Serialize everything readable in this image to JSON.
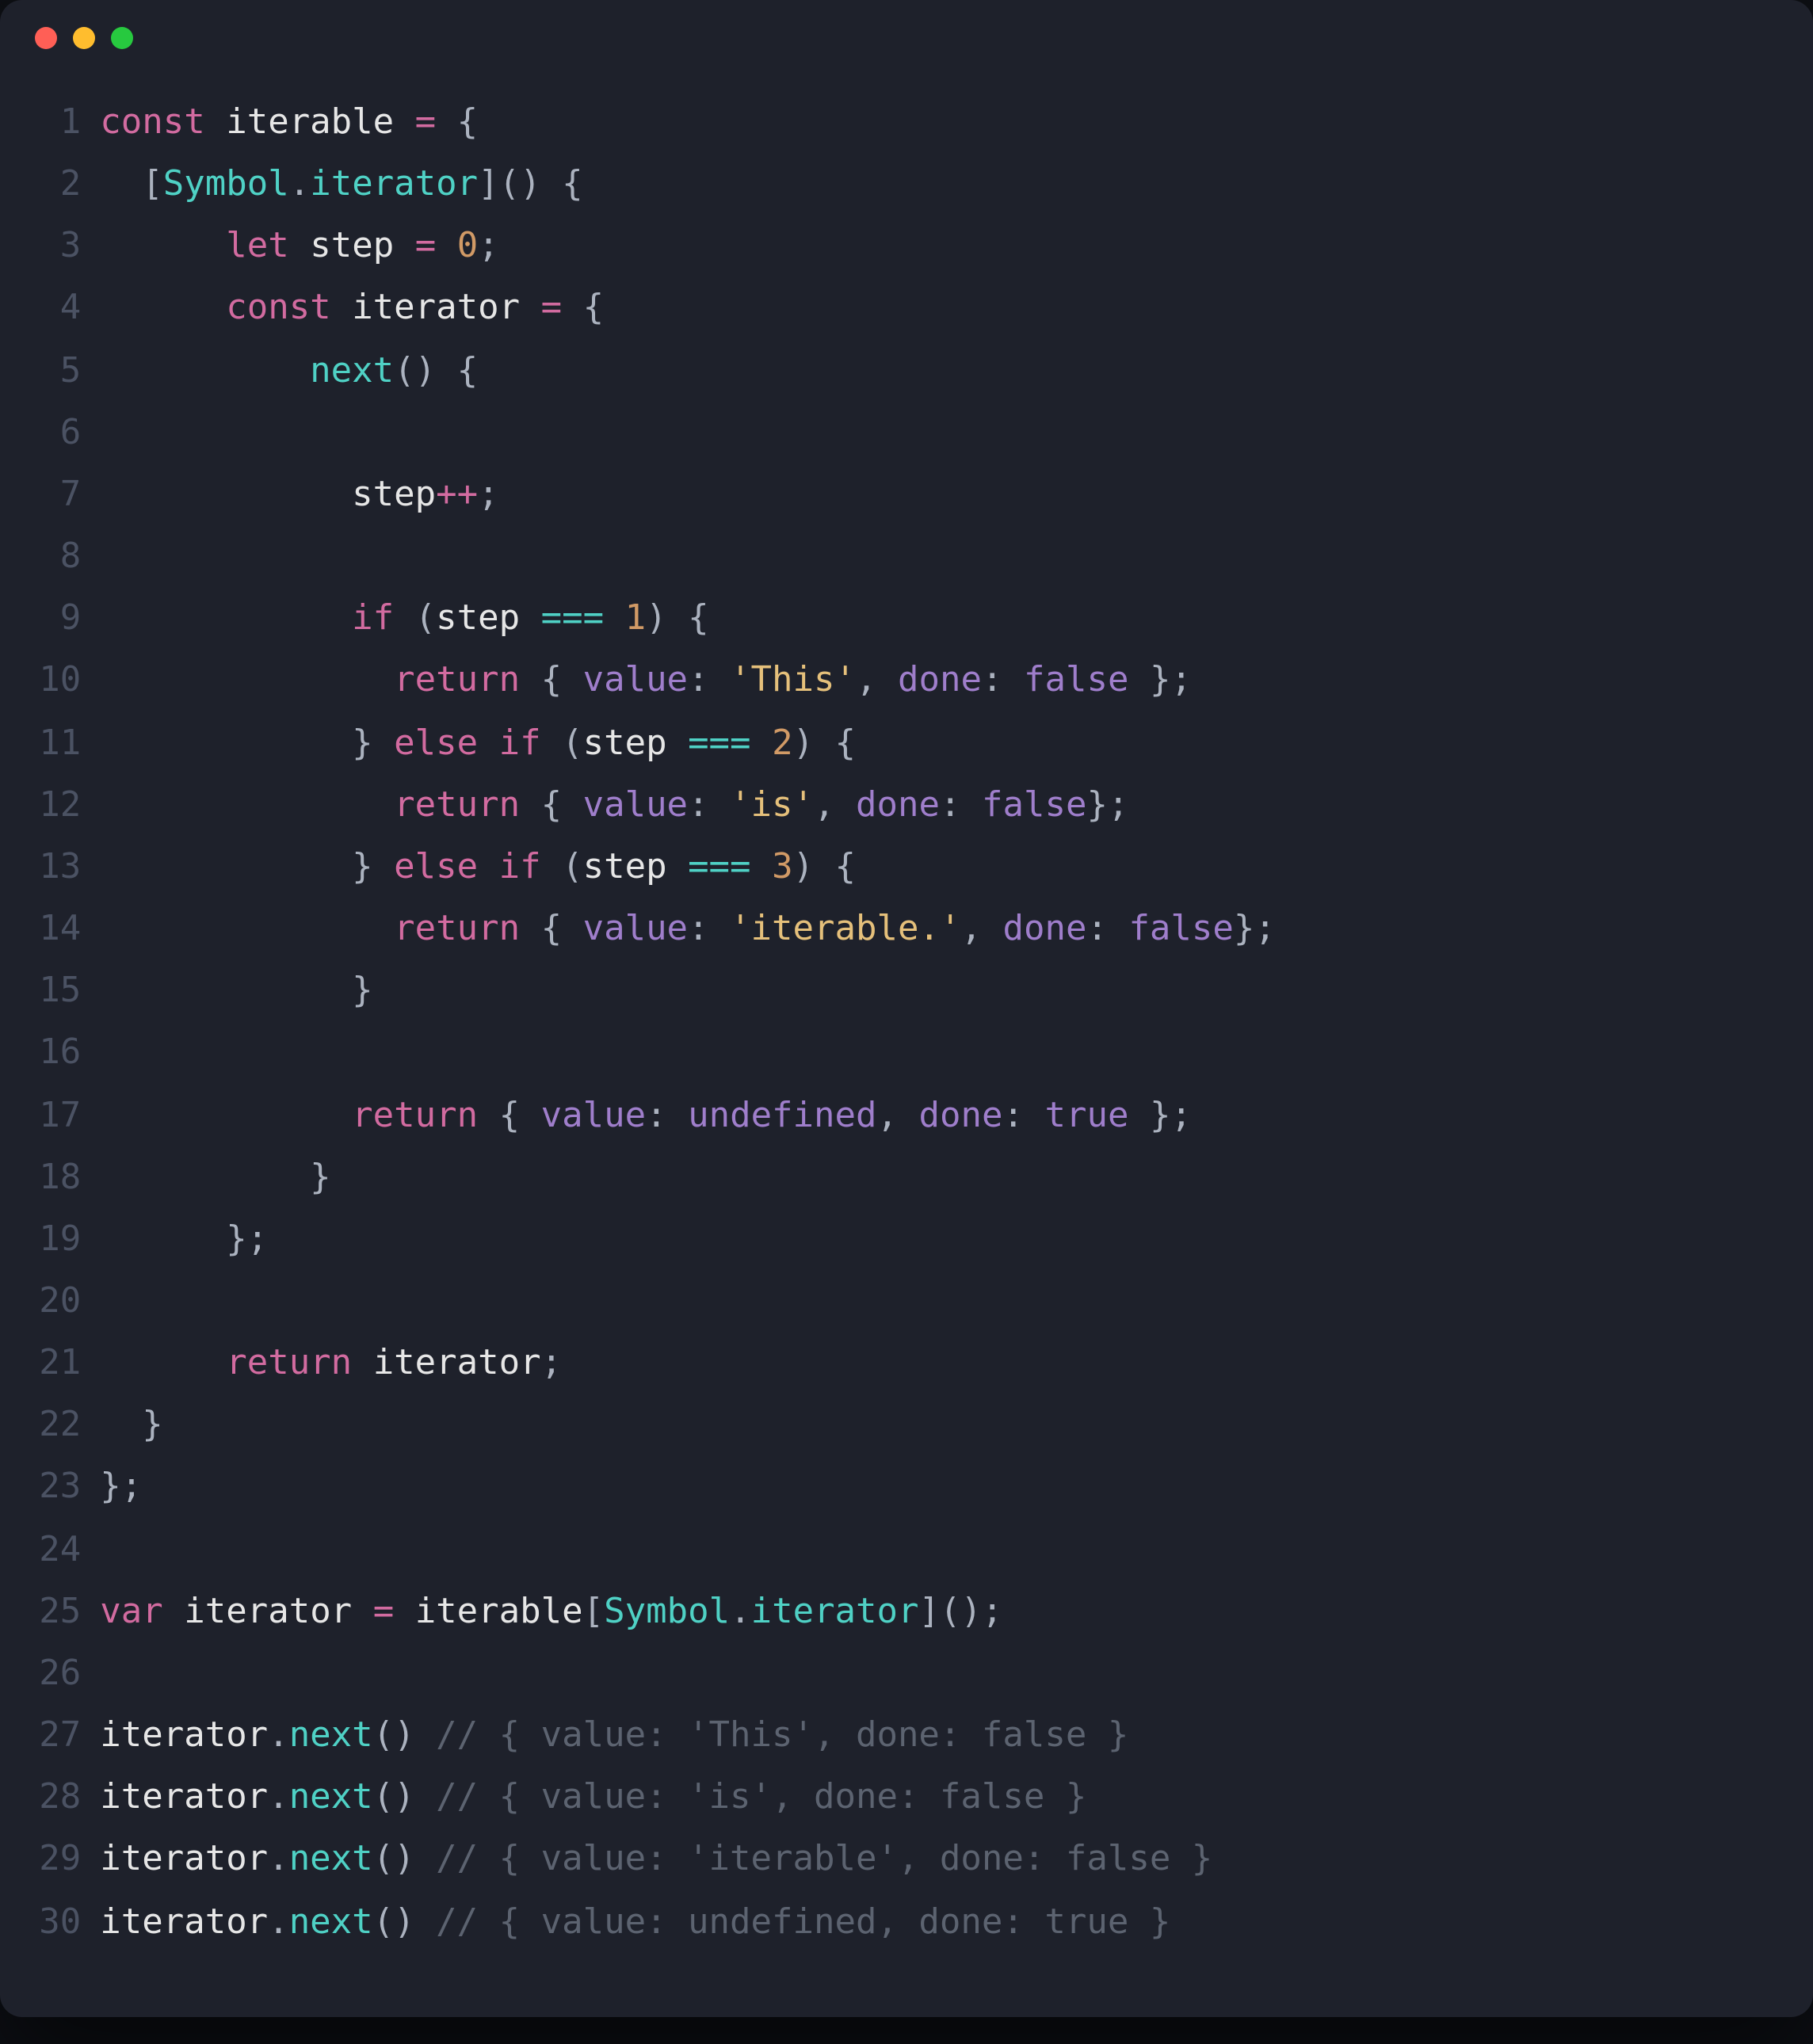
{
  "window": {
    "dots": [
      "red",
      "yellow",
      "green"
    ]
  },
  "lines": [
    {
      "n": "1",
      "tokens": [
        [
          "k",
          "const"
        ],
        [
          "p",
          " "
        ],
        [
          "id",
          "iterable"
        ],
        [
          "p",
          " "
        ],
        [
          "k",
          "="
        ],
        [
          "p",
          " {"
        ]
      ]
    },
    {
      "n": "2",
      "tokens": [
        [
          "p",
          "  ["
        ],
        [
          "fn",
          "Symbol"
        ],
        [
          "p",
          "."
        ],
        [
          "fn",
          "iterator"
        ],
        [
          "p",
          "]() {"
        ]
      ]
    },
    {
      "n": "3",
      "tokens": [
        [
          "p",
          "      "
        ],
        [
          "k",
          "let"
        ],
        [
          "p",
          " "
        ],
        [
          "id",
          "step"
        ],
        [
          "p",
          " "
        ],
        [
          "k",
          "="
        ],
        [
          "p",
          " "
        ],
        [
          "n",
          "0"
        ],
        [
          "p",
          ";"
        ]
      ]
    },
    {
      "n": "4",
      "tokens": [
        [
          "p",
          "      "
        ],
        [
          "k",
          "const"
        ],
        [
          "p",
          " "
        ],
        [
          "id",
          "iterator"
        ],
        [
          "p",
          " "
        ],
        [
          "k",
          "="
        ],
        [
          "p",
          " {"
        ]
      ]
    },
    {
      "n": "5",
      "tokens": [
        [
          "p",
          "          "
        ],
        [
          "fn",
          "next"
        ],
        [
          "p",
          "() {"
        ]
      ]
    },
    {
      "n": "6",
      "tokens": [
        [
          "p",
          ""
        ]
      ]
    },
    {
      "n": "7",
      "tokens": [
        [
          "p",
          "            "
        ],
        [
          "id",
          "step"
        ],
        [
          "k",
          "++"
        ],
        [
          "p",
          ";"
        ]
      ]
    },
    {
      "n": "8",
      "tokens": [
        [
          "p",
          ""
        ]
      ]
    },
    {
      "n": "9",
      "tokens": [
        [
          "p",
          "            "
        ],
        [
          "k",
          "if"
        ],
        [
          "p",
          " ("
        ],
        [
          "id",
          "step"
        ],
        [
          "p",
          " "
        ],
        [
          "op",
          "==="
        ],
        [
          "p",
          " "
        ],
        [
          "n",
          "1"
        ],
        [
          "p",
          ") {"
        ]
      ]
    },
    {
      "n": "10",
      "tokens": [
        [
          "p",
          "              "
        ],
        [
          "k",
          "return"
        ],
        [
          "p",
          " { "
        ],
        [
          "prop",
          "value"
        ],
        [
          "p",
          ": "
        ],
        [
          "s",
          "'This'"
        ],
        [
          "p",
          ", "
        ],
        [
          "prop",
          "done"
        ],
        [
          "p",
          ": "
        ],
        [
          "kw2",
          "false"
        ],
        [
          "p",
          " };"
        ]
      ]
    },
    {
      "n": "11",
      "tokens": [
        [
          "p",
          "            } "
        ],
        [
          "k",
          "else"
        ],
        [
          "p",
          " "
        ],
        [
          "k",
          "if"
        ],
        [
          "p",
          " ("
        ],
        [
          "id",
          "step"
        ],
        [
          "p",
          " "
        ],
        [
          "op",
          "==="
        ],
        [
          "p",
          " "
        ],
        [
          "n",
          "2"
        ],
        [
          "p",
          ") {"
        ]
      ]
    },
    {
      "n": "12",
      "tokens": [
        [
          "p",
          "              "
        ],
        [
          "k",
          "return"
        ],
        [
          "p",
          " { "
        ],
        [
          "prop",
          "value"
        ],
        [
          "p",
          ": "
        ],
        [
          "s",
          "'is'"
        ],
        [
          "p",
          ", "
        ],
        [
          "prop",
          "done"
        ],
        [
          "p",
          ": "
        ],
        [
          "kw2",
          "false"
        ],
        [
          "p",
          "};"
        ]
      ]
    },
    {
      "n": "13",
      "tokens": [
        [
          "p",
          "            } "
        ],
        [
          "k",
          "else"
        ],
        [
          "p",
          " "
        ],
        [
          "k",
          "if"
        ],
        [
          "p",
          " ("
        ],
        [
          "id",
          "step"
        ],
        [
          "p",
          " "
        ],
        [
          "op",
          "==="
        ],
        [
          "p",
          " "
        ],
        [
          "n",
          "3"
        ],
        [
          "p",
          ") {"
        ]
      ]
    },
    {
      "n": "14",
      "tokens": [
        [
          "p",
          "              "
        ],
        [
          "k",
          "return"
        ],
        [
          "p",
          " { "
        ],
        [
          "prop",
          "value"
        ],
        [
          "p",
          ": "
        ],
        [
          "s",
          "'iterable.'"
        ],
        [
          "p",
          ", "
        ],
        [
          "prop",
          "done"
        ],
        [
          "p",
          ": "
        ],
        [
          "kw2",
          "false"
        ],
        [
          "p",
          "};"
        ]
      ]
    },
    {
      "n": "15",
      "tokens": [
        [
          "p",
          "            }"
        ]
      ]
    },
    {
      "n": "16",
      "tokens": [
        [
          "p",
          ""
        ]
      ]
    },
    {
      "n": "17",
      "tokens": [
        [
          "p",
          "            "
        ],
        [
          "k",
          "return"
        ],
        [
          "p",
          " { "
        ],
        [
          "prop",
          "value"
        ],
        [
          "p",
          ": "
        ],
        [
          "kw2",
          "undefined"
        ],
        [
          "p",
          ", "
        ],
        [
          "prop",
          "done"
        ],
        [
          "p",
          ": "
        ],
        [
          "kw2",
          "true"
        ],
        [
          "p",
          " };"
        ]
      ]
    },
    {
      "n": "18",
      "tokens": [
        [
          "p",
          "          }"
        ]
      ]
    },
    {
      "n": "19",
      "tokens": [
        [
          "p",
          "      };"
        ]
      ]
    },
    {
      "n": "20",
      "tokens": [
        [
          "p",
          ""
        ]
      ]
    },
    {
      "n": "21",
      "tokens": [
        [
          "p",
          "      "
        ],
        [
          "k",
          "return"
        ],
        [
          "p",
          " "
        ],
        [
          "id",
          "iterator"
        ],
        [
          "p",
          ";"
        ]
      ]
    },
    {
      "n": "22",
      "tokens": [
        [
          "p",
          "  }"
        ]
      ]
    },
    {
      "n": "23",
      "tokens": [
        [
          "p",
          "};"
        ]
      ]
    },
    {
      "n": "24",
      "tokens": [
        [
          "p",
          ""
        ]
      ]
    },
    {
      "n": "25",
      "tokens": [
        [
          "k",
          "var"
        ],
        [
          "p",
          " "
        ],
        [
          "id",
          "iterator"
        ],
        [
          "p",
          " "
        ],
        [
          "k",
          "="
        ],
        [
          "p",
          " "
        ],
        [
          "id",
          "iterable"
        ],
        [
          "p",
          "["
        ],
        [
          "fn",
          "Symbol"
        ],
        [
          "p",
          "."
        ],
        [
          "fn",
          "iterator"
        ],
        [
          "p",
          "]();"
        ]
      ]
    },
    {
      "n": "26",
      "tokens": [
        [
          "p",
          ""
        ]
      ]
    },
    {
      "n": "27",
      "tokens": [
        [
          "id",
          "iterator"
        ],
        [
          "p",
          "."
        ],
        [
          "fn",
          "next"
        ],
        [
          "p",
          "() "
        ],
        [
          "cm",
          "// { value: 'This', done: false }"
        ]
      ]
    },
    {
      "n": "28",
      "tokens": [
        [
          "id",
          "iterator"
        ],
        [
          "p",
          "."
        ],
        [
          "fn",
          "next"
        ],
        [
          "p",
          "() "
        ],
        [
          "cm",
          "// { value: 'is', done: false }"
        ]
      ]
    },
    {
      "n": "29",
      "tokens": [
        [
          "id",
          "iterator"
        ],
        [
          "p",
          "."
        ],
        [
          "fn",
          "next"
        ],
        [
          "p",
          "() "
        ],
        [
          "cm",
          "// { value: 'iterable', done: false }"
        ]
      ]
    },
    {
      "n": "30",
      "tokens": [
        [
          "id",
          "iterator"
        ],
        [
          "p",
          "."
        ],
        [
          "fn",
          "next"
        ],
        [
          "p",
          "() "
        ],
        [
          "cm",
          "// { value: undefined, done: true }"
        ]
      ]
    }
  ]
}
